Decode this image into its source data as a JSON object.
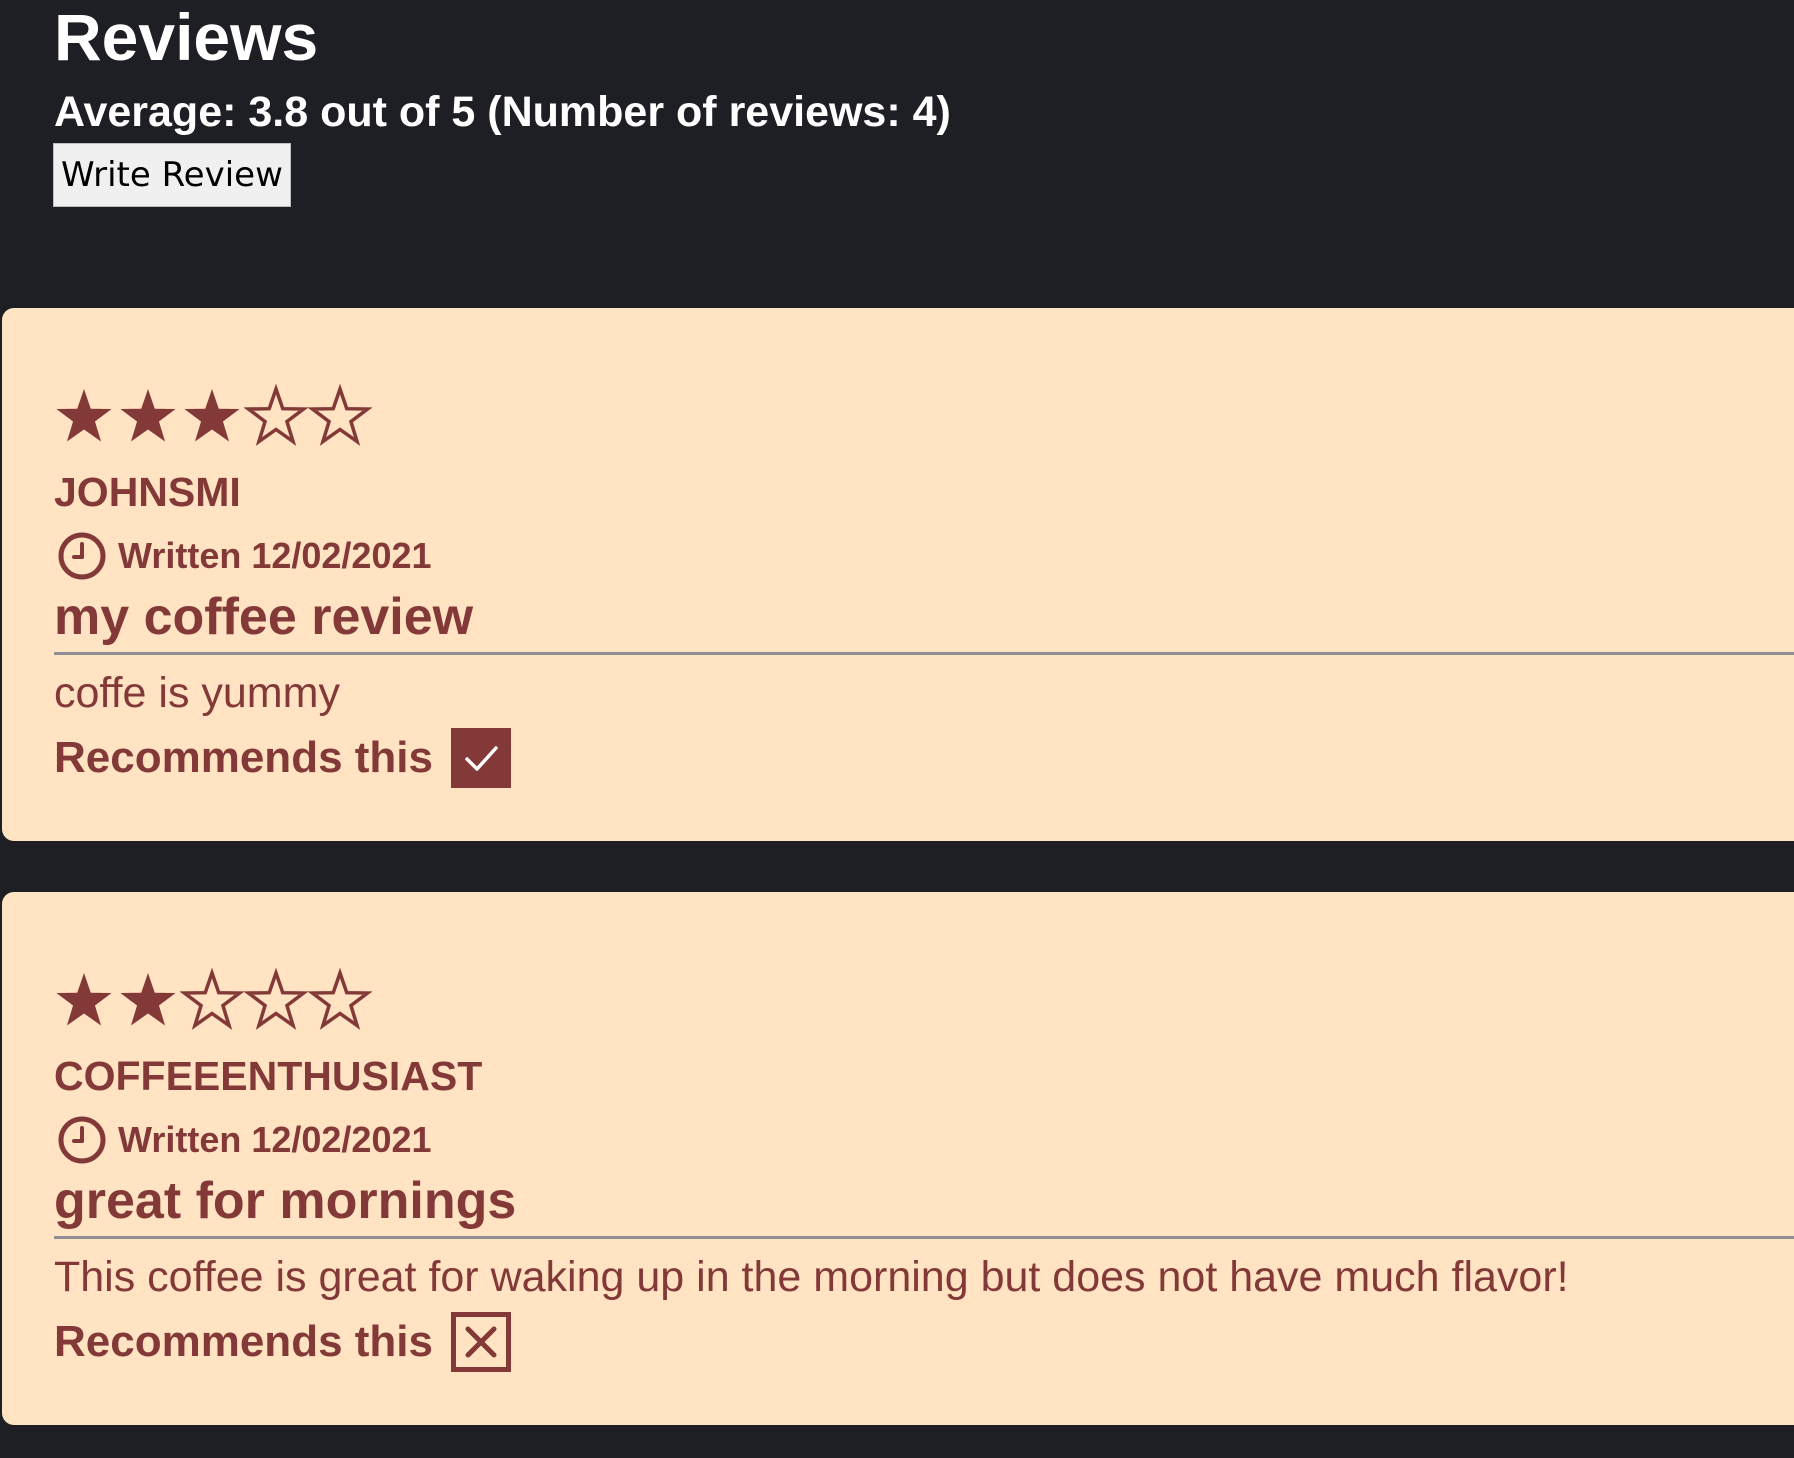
{
  "header": {
    "title": "Reviews",
    "average_text": "Average: 3.8 out of 5 (Number of reviews: 4)",
    "write_review_label": "Write Review"
  },
  "colors": {
    "page_background": "#1d1f24",
    "card_background": "#ffe3c2",
    "accent": "#833938",
    "divider": "#8f8f95"
  },
  "reviews": [
    {
      "rating": 3,
      "max_rating": 5,
      "username": "JOHNSMI",
      "written": "Written 12/02/2021",
      "title": "my coffee review",
      "body": "coffe is yummy",
      "recommends_label": "Recommends this",
      "recommends": true,
      "recommend_icon": "check-icon"
    },
    {
      "rating": 2,
      "max_rating": 5,
      "username": "COFFEEENTHUSIAST",
      "written": "Written 12/02/2021",
      "title": "great for mornings",
      "body": "This coffee is great for waking up in the morning but does not have much flavor!",
      "recommends_label": "Recommends this",
      "recommends": false,
      "recommend_icon": "x-icon"
    }
  ]
}
